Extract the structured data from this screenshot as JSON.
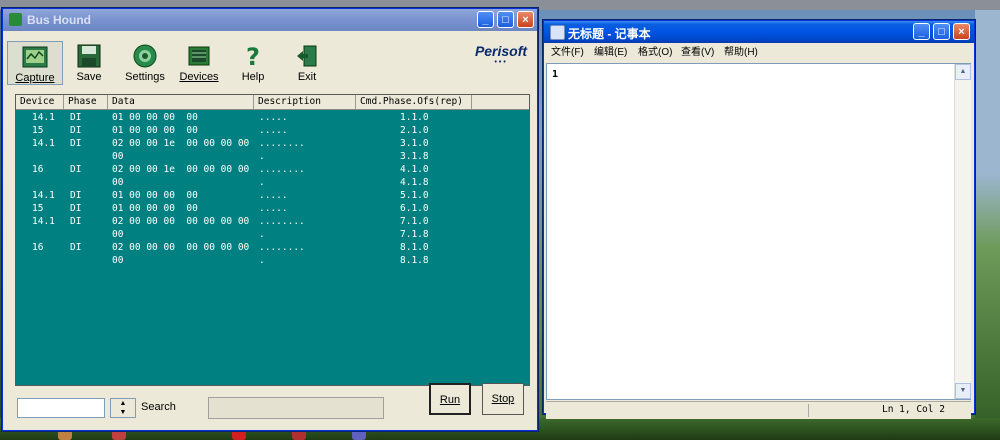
{
  "bus_hound": {
    "title": "Bus Hound",
    "toolbar": [
      {
        "label": "Capture",
        "icon": "capture-icon"
      },
      {
        "label": "Save",
        "icon": "floppy-icon"
      },
      {
        "label": "Settings",
        "icon": "gear-icon"
      },
      {
        "label": "Devices",
        "icon": "chip-icon"
      },
      {
        "label": "Help",
        "icon": "question-icon"
      },
      {
        "label": "Exit",
        "icon": "exit-door-icon"
      }
    ],
    "logo": "Perisoft",
    "columns": [
      "Device",
      "Phase",
      "Data",
      "Description",
      "Cmd.Phase.Ofs(rep)"
    ],
    "rows": [
      {
        "device": "14.1",
        "phase": "DI",
        "data": "01 00 00 00  00",
        "desc": ".....",
        "cmd": "1.1.0"
      },
      {
        "device": "15",
        "phase": "DI",
        "data": "01 00 00 00  00",
        "desc": ".....",
        "cmd": "2.1.0"
      },
      {
        "device": "14.1",
        "phase": "DI",
        "data": "02 00 00 1e  00 00 00 00",
        "desc": "........",
        "cmd": "3.1.0"
      },
      {
        "device": "",
        "phase": "",
        "data": "00",
        "desc": ".",
        "cmd": "3.1.8"
      },
      {
        "device": "16",
        "phase": "DI",
        "data": "02 00 00 1e  00 00 00 00",
        "desc": "........",
        "cmd": "4.1.0"
      },
      {
        "device": "",
        "phase": "",
        "data": "00",
        "desc": ".",
        "cmd": "4.1.8"
      },
      {
        "device": "14.1",
        "phase": "DI",
        "data": "01 00 00 00  00",
        "desc": ".....",
        "cmd": "5.1.0"
      },
      {
        "device": "15",
        "phase": "DI",
        "data": "01 00 00 00  00",
        "desc": ".....",
        "cmd": "6.1.0"
      },
      {
        "device": "14.1",
        "phase": "DI",
        "data": "02 00 00 00  00 00 00 00",
        "desc": "........",
        "cmd": "7.1.0"
      },
      {
        "device": "",
        "phase": "",
        "data": "00",
        "desc": ".",
        "cmd": "7.1.8"
      },
      {
        "device": "16",
        "phase": "DI",
        "data": "02 00 00 00  00 00 00 00",
        "desc": "........",
        "cmd": "8.1.0"
      },
      {
        "device": "",
        "phase": "",
        "data": "00",
        "desc": ".",
        "cmd": "8.1.8"
      }
    ],
    "search_label": "Search",
    "search_value": "",
    "run_label": "Run",
    "stop_label": "Stop",
    "panel_color": "#008080"
  },
  "notepad": {
    "title": "无标题 - 记事本",
    "menu": [
      "文件(F)",
      "编辑(E)",
      "格式(O)",
      "查看(V)",
      "帮助(H)"
    ],
    "content": "1",
    "status": "Ln 1, Col 2"
  }
}
